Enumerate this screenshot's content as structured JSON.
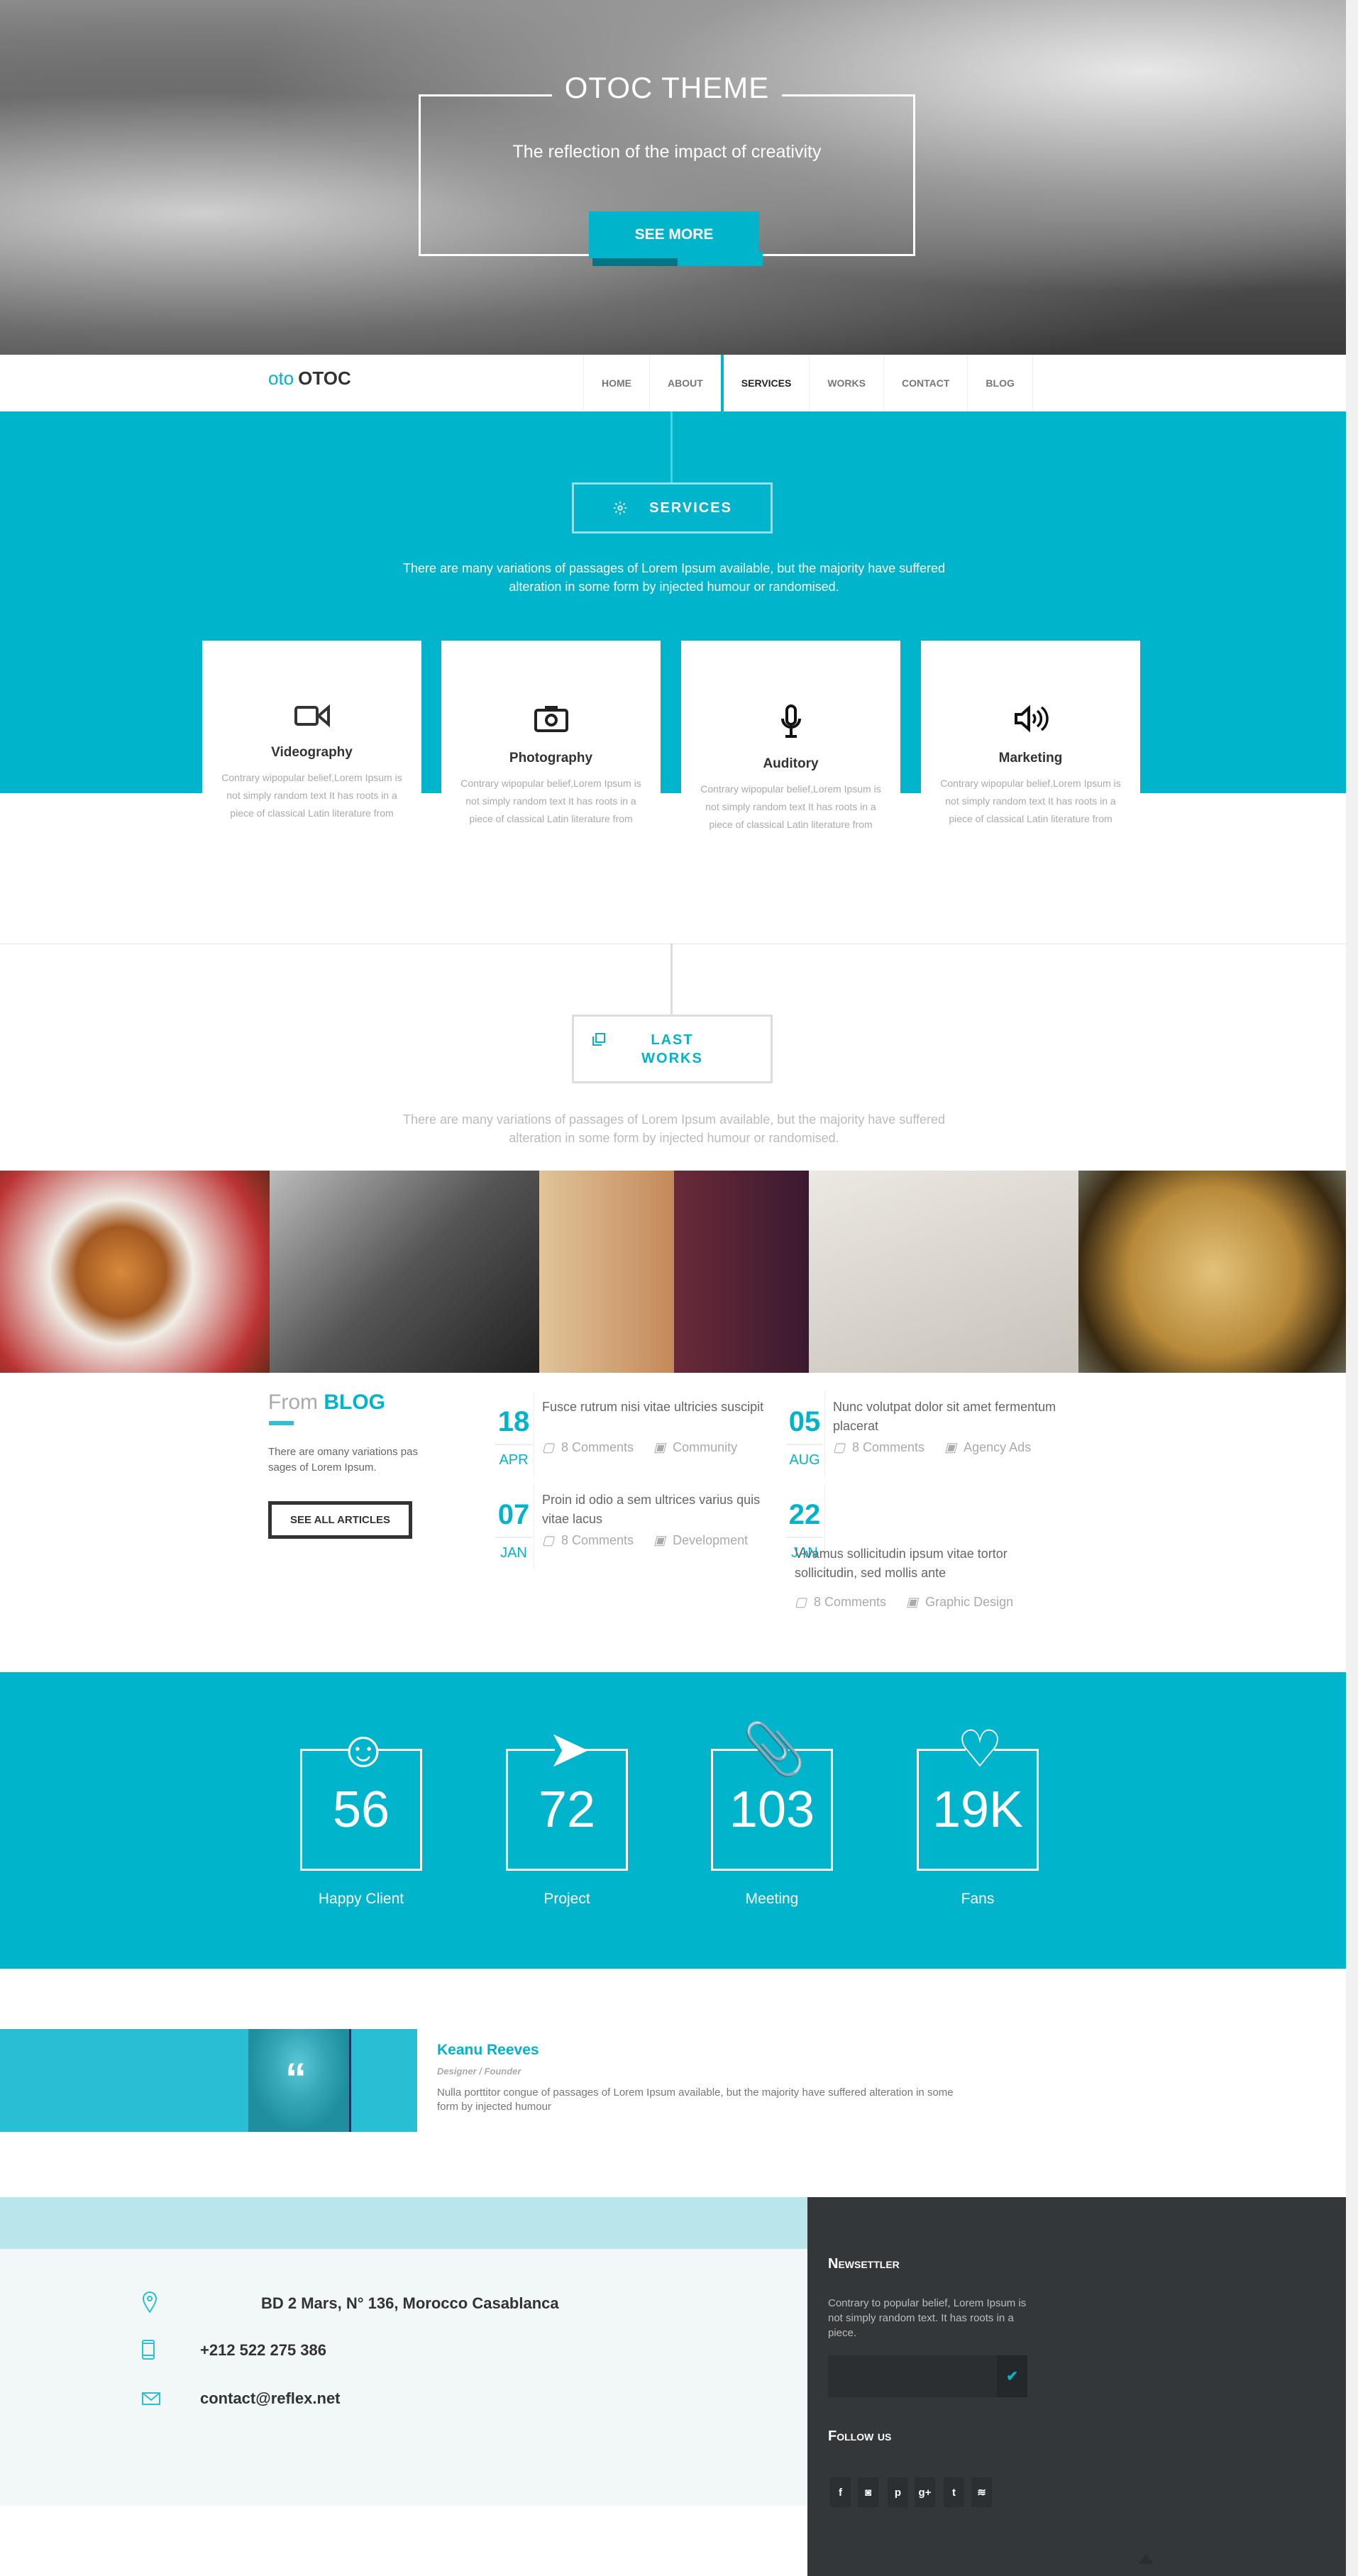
{
  "hero": {
    "title": "OTOC THEME",
    "subtitle": "The reflection of the impact of creativity",
    "button": "SEE MORE"
  },
  "nav": {
    "logo_mark": "oto",
    "logo_text": "OTOC",
    "items": [
      {
        "label": "HOME"
      },
      {
        "label": "ABOUT"
      },
      {
        "label": "SERVICES",
        "active": true
      },
      {
        "label": "WORKS"
      },
      {
        "label": "CONTACT"
      },
      {
        "label": "BLOG"
      }
    ]
  },
  "services": {
    "title": "SERVICES",
    "description": "There are many variations of passages of Lorem Ipsum available, but the majority have suffered alteration in some form by injected humour or randomised.",
    "cards": [
      {
        "icon": "video-camera-icon",
        "title": "Videography",
        "text": "Contrary wipopular belief,Lorem Ipsum is not simply random text It has roots in a piece of classical Latin literature from"
      },
      {
        "icon": "camera-icon",
        "title": "Photography",
        "text": "Contrary wipopular belief,Lorem Ipsum is not simply random text It has roots in a piece of classical Latin literature from"
      },
      {
        "icon": "microphone-icon",
        "title": "Auditory",
        "text": "Contrary wipopular belief,Lorem Ipsum is not simply random text It has roots in a piece of classical Latin literature from"
      },
      {
        "icon": "speaker-icon",
        "title": "Marketing",
        "text": "Contrary wipopular belief,Lorem Ipsum is not simply random text It has roots in a piece of classical Latin literature from"
      }
    ]
  },
  "works": {
    "title_line1": "LAST",
    "title_line2": "WORKS",
    "description": "There are many variations of passages of Lorem Ipsum available, but the majority have suffered alteration in some form by injected humour or randomised."
  },
  "blog": {
    "title_prefix": "From",
    "title_accent": "BLOG",
    "description": "There are omany variations pas sages of Lorem Ipsum.",
    "button": "SEE ALL ARTICLES",
    "posts": [
      {
        "day": "18",
        "month": "APR",
        "title": "Fusce rutrum nisi vitae ultricies suscipit",
        "comments": "8 Comments",
        "category": "Community"
      },
      {
        "day": "05",
        "month": "AUG",
        "title": "Nunc volutpat dolor sit amet fermentum placerat",
        "comments": "8 Comments",
        "category": "Agency Ads"
      },
      {
        "day": "07",
        "month": "JAN",
        "title": "Proin id odio a sem ultrices varius quis vitae lacus",
        "comments": "8 Comments",
        "category": "Development"
      },
      {
        "day": "22",
        "month": "JAN",
        "title": "Vivamus sollicitudin ipsum vitae tortor sollicitudin, sed mollis ante",
        "comments": "8 Comments",
        "category": "Graphic Design"
      }
    ]
  },
  "stats": [
    {
      "icon": "user-icon",
      "value": "56",
      "label": "Happy Client"
    },
    {
      "icon": "paper-plane-icon",
      "value": "72",
      "label": "Project"
    },
    {
      "icon": "paperclip-icon",
      "value": "103",
      "label": "Meeting"
    },
    {
      "icon": "heart-icon",
      "value": "19K",
      "label": "Fans"
    }
  ],
  "testimonial": {
    "name": "Keanu Reeves",
    "role": "Designer / Founder",
    "text": "Nulla porttitor congue of passages of Lorem Ipsum available, but the majority have suffered alteration in some form by injected humour"
  },
  "contact": {
    "address": "BD 2 Mars, N° 136, Morocco Casablanca",
    "phone": "+212 522 275 386",
    "email": "contact@reflex.net"
  },
  "newsletter": {
    "title": "Newsettler",
    "text": "Contrary to popular belief, Lorem Ipsum is not simply random text. It has roots in a piece.",
    "input_value": ""
  },
  "follow": {
    "title": "Follow us",
    "networks": [
      {
        "icon": "facebook-icon",
        "glyph": "f"
      },
      {
        "icon": "instagram-icon",
        "glyph": "◙"
      },
      {
        "icon": "pinterest-icon",
        "glyph": "p"
      },
      {
        "icon": "google-plus-icon",
        "glyph": "g+"
      },
      {
        "icon": "twitter-icon",
        "glyph": "t"
      },
      {
        "icon": "rss-icon",
        "glyph": "≋"
      }
    ]
  },
  "colors": {
    "accent": "#00b4cc",
    "dark": "#343739",
    "footer_light": "#f2f7f8"
  }
}
